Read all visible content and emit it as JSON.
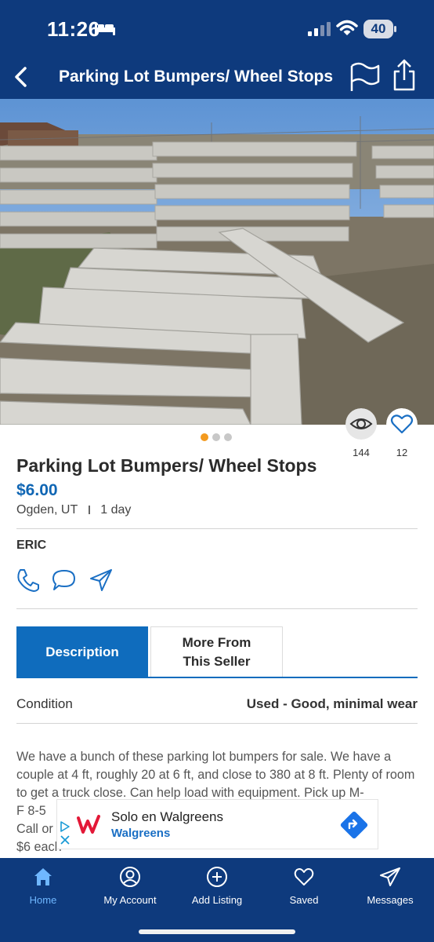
{
  "status_bar": {
    "time": "11:26",
    "battery": "40"
  },
  "nav": {
    "title": "Parking Lot Bumpers/ Wheel Stops"
  },
  "gallery": {
    "dots": 3,
    "active_dot": 0,
    "active_color": "#f39a1f"
  },
  "stats": {
    "views": "144",
    "likes": "12"
  },
  "listing": {
    "title": "Parking Lot Bumpers/ Wheel Stops",
    "price": "$6.00",
    "location": "Ogden, UT",
    "age": "1 day",
    "seller": "ERIC"
  },
  "tabs": {
    "description": "Description",
    "more_from_seller": "More From This Seller"
  },
  "details": {
    "condition_label": "Condition",
    "condition_value": "Used - Good, minimal wear"
  },
  "description": {
    "line1": "We have a bunch of these parking lot bumpers for sale. We have a couple at 4 ft, roughly 20 at 6 ft, and close to 380 at 8 ft. Plenty of room to get a truck close.  Can help load with equipment. Pick up M-",
    "line2": "F 8-5",
    "line3": "Call or",
    "line4": "$6 each"
  },
  "ad": {
    "headline": "Solo en Walgreens",
    "brand": "Walgreens"
  },
  "bottom_nav": [
    {
      "label": "Home",
      "icon": "home-icon",
      "active": true
    },
    {
      "label": "My Account",
      "icon": "user-icon",
      "active": false
    },
    {
      "label": "Add Listing",
      "icon": "plus-circle-icon",
      "active": false
    },
    {
      "label": "Saved",
      "icon": "heart-icon",
      "active": false
    },
    {
      "label": "Messages",
      "icon": "paper-plane-icon",
      "active": false
    }
  ],
  "colors": {
    "header": "#0e3a7d",
    "accent": "#0f6cbd",
    "price": "#1066b4",
    "orange": "#f39a1f"
  }
}
